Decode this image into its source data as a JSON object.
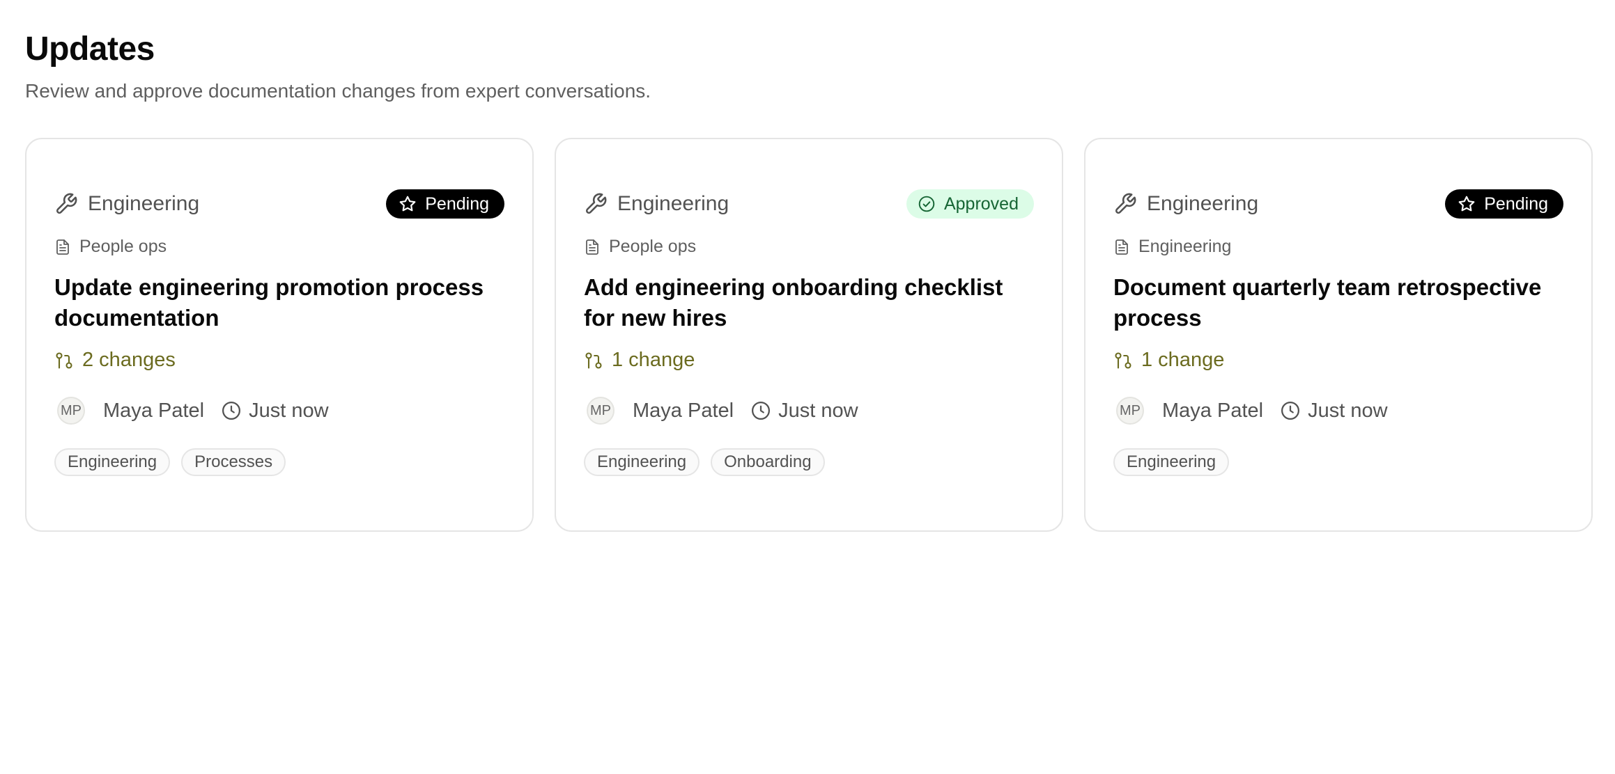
{
  "header": {
    "title": "Updates",
    "subtitle": "Review and approve documentation changes from expert conversations."
  },
  "colors": {
    "pending_badge_bg": "#000000",
    "approved_badge_bg": "#dcfce7",
    "approved_badge_text": "#166534",
    "changes_text": "#6b6b1f"
  },
  "cards": [
    {
      "category": "Engineering",
      "category_icon": "wrench-icon",
      "status": "Pending",
      "status_icon": "star-icon",
      "space": "People ops",
      "space_icon": "document-icon",
      "title": "Update engineering promotion process documentation",
      "changes": "2 changes",
      "changes_icon": "git-compare-icon",
      "avatar_initials": "MP",
      "author": "Maya Patel",
      "time": "Just now",
      "tags": [
        "Engineering",
        "Processes"
      ]
    },
    {
      "category": "Engineering",
      "category_icon": "wrench-icon",
      "status": "Approved",
      "status_icon": "check-circle-icon",
      "space": "People ops",
      "space_icon": "document-icon",
      "title": "Add engineering onboarding checklist for new hires",
      "changes": "1 change",
      "changes_icon": "git-compare-icon",
      "avatar_initials": "MP",
      "author": "Maya Patel",
      "time": "Just now",
      "tags": [
        "Engineering",
        "Onboarding"
      ]
    },
    {
      "category": "Engineering",
      "category_icon": "wrench-icon",
      "status": "Pending",
      "status_icon": "star-icon",
      "space": "Engineering",
      "space_icon": "document-icon",
      "title": "Document quarterly team retrospective process",
      "changes": "1 change",
      "changes_icon": "git-compare-icon",
      "avatar_initials": "MP",
      "author": "Maya Patel",
      "time": "Just now",
      "tags": [
        "Engineering"
      ]
    }
  ]
}
